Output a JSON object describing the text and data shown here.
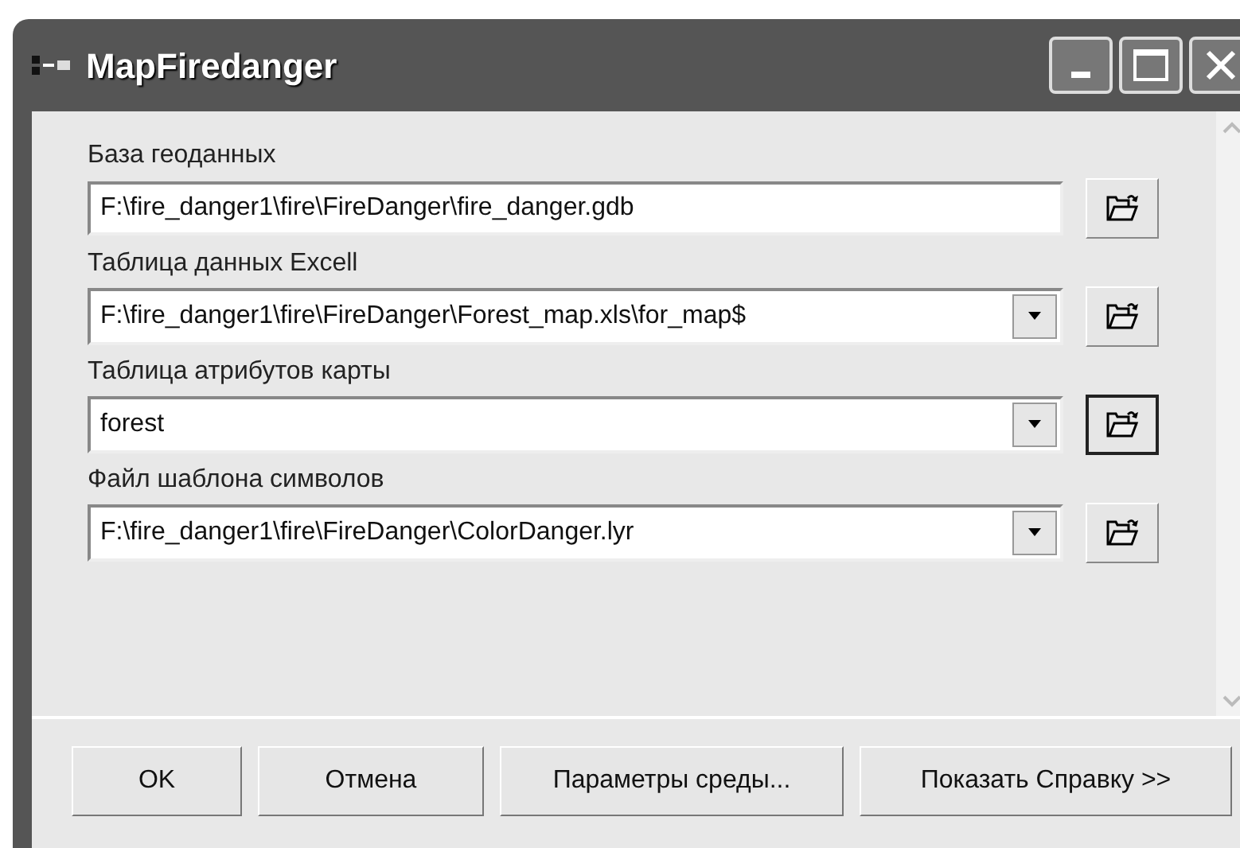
{
  "window": {
    "title": "MapFiredanger"
  },
  "fields": [
    {
      "label": "База геоданных",
      "value": "F:\\fire_danger1\\fire\\FireDanger\\fire_danger.gdb",
      "kind": "text",
      "browse_focused": false
    },
    {
      "label": "Таблица данных Excell",
      "value": "F:\\fire_danger1\\fire\\FireDanger\\Forest_map.xls\\for_map$",
      "kind": "combo",
      "browse_focused": false
    },
    {
      "label": "Таблица атрибутов карты",
      "value": "forest",
      "kind": "combo",
      "browse_focused": true
    },
    {
      "label": "Файл шаблона символов",
      "value": "F:\\fire_danger1\\fire\\FireDanger\\ColorDanger.lyr",
      "kind": "combo",
      "browse_focused": false
    }
  ],
  "buttons": [
    "OK",
    "Отмена",
    "Параметры среды...",
    "Показать Справку >>"
  ]
}
